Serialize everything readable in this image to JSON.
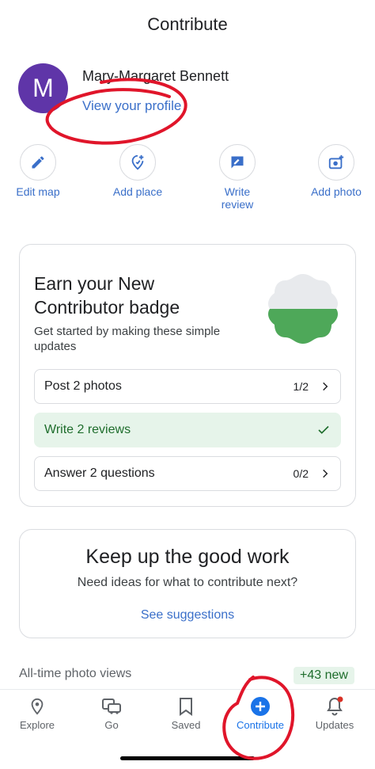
{
  "header": {
    "title": "Contribute"
  },
  "profile": {
    "avatar_letter": "M",
    "avatar_color": "#5f35a8",
    "name": "Mary-Margaret Bennett",
    "link": "View your profile"
  },
  "actions": [
    {
      "label": "Edit map",
      "icon": "pencil-icon"
    },
    {
      "label": "Add place",
      "icon": "add-place-icon"
    },
    {
      "label": "Write review",
      "icon": "review-icon"
    },
    {
      "label": "Add photo",
      "icon": "add-photo-icon"
    }
  ],
  "badge_card": {
    "title": "Earn your New Contributor badge",
    "subtitle": "Get started by making these simple updates",
    "progress_fraction": 0.5,
    "tasks": [
      {
        "label": "Post 2 photos",
        "count": "1/2",
        "done": false
      },
      {
        "label": "Write 2 reviews",
        "count": "",
        "done": true
      },
      {
        "label": "Answer 2 questions",
        "count": "0/2",
        "done": false
      }
    ]
  },
  "encourage_card": {
    "title": "Keep up the good work",
    "subtitle": "Need ideas for what to contribute next?",
    "link": "See suggestions"
  },
  "stats": {
    "label": "All-time photo views",
    "badge": "+43 new"
  },
  "bottom_nav": [
    {
      "label": "Explore",
      "icon": "location-pin-icon",
      "active": false
    },
    {
      "label": "Go",
      "icon": "car-icon",
      "active": false
    },
    {
      "label": "Saved",
      "icon": "bookmark-icon",
      "active": false
    },
    {
      "label": "Contribute",
      "icon": "plus-circle-icon",
      "active": true
    },
    {
      "label": "Updates",
      "icon": "bell-icon",
      "active": false
    }
  ],
  "colors": {
    "accent": "#1a73e8",
    "link": "#3a6fc9",
    "success": "#1e6d2c",
    "success_bg": "#e6f4ea",
    "annotation": "#e0152a"
  }
}
